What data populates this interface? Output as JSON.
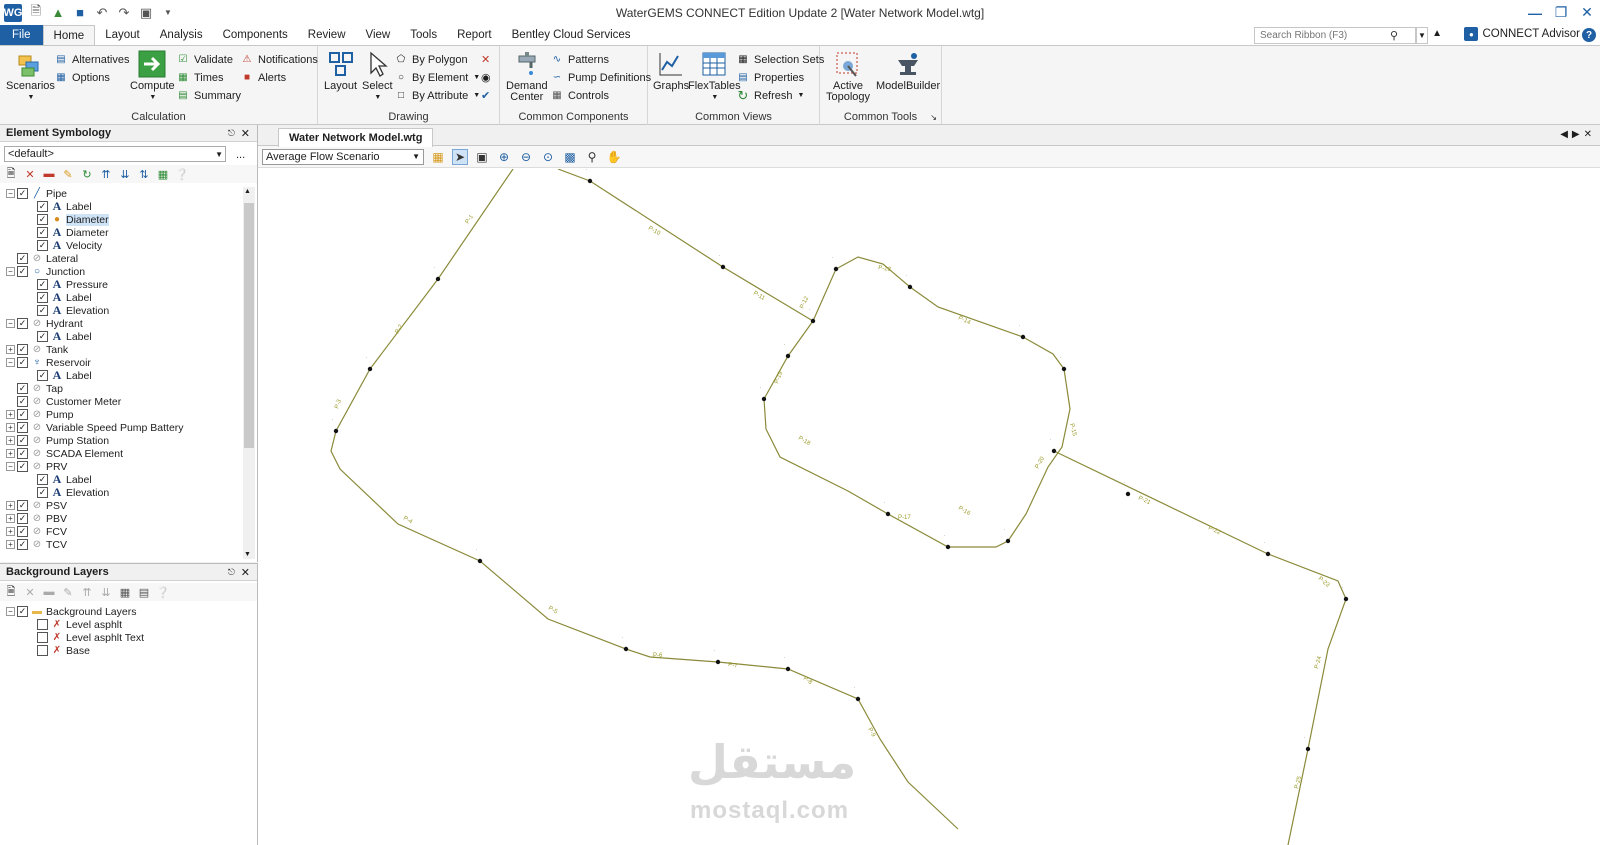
{
  "window": {
    "title": "WaterGEMS CONNECT Edition Update 2 [Water Network Model.wtg]",
    "logo": "WG",
    "controls": [
      "minimize-icon",
      "restore-icon",
      "close-icon"
    ]
  },
  "ribbon_tabs": [
    "File",
    "Home",
    "Layout",
    "Analysis",
    "Components",
    "Review",
    "View",
    "Tools",
    "Report",
    "Bentley Cloud Services"
  ],
  "active_tab": "Home",
  "search": {
    "placeholder": "Search Ribbon (F3)"
  },
  "connect_advisor": "CONNECT Advisor",
  "groups": {
    "calculation": {
      "label": "Calculation",
      "scenarios": "Scenarios",
      "alternatives": "Alternatives",
      "options": "Options",
      "compute": "Compute",
      "validate": "Validate",
      "times": "Times",
      "summary": "Summary",
      "notifications": "Notifications",
      "alerts": "Alerts"
    },
    "drawing": {
      "label": "Drawing",
      "layout": "Layout",
      "select": "Select",
      "by_polygon": "By Polygon",
      "by_element": "By Element",
      "by_attribute": "By Attribute"
    },
    "common_components": {
      "label": "Common Components",
      "demand_center_1": "Demand",
      "demand_center_2": "Center",
      "patterns": "Patterns",
      "pump_definitions": "Pump Definitions",
      "controls": "Controls"
    },
    "common_views": {
      "label": "Common Views",
      "graphs": "Graphs",
      "flextables": "FlexTables",
      "selection_sets": "Selection Sets",
      "properties": "Properties",
      "refresh": "Refresh"
    },
    "common_tools": {
      "label": "Common Tools",
      "active_topology_1": "Active",
      "active_topology_2": "Topology",
      "modelbuilder": "ModelBuilder"
    }
  },
  "symbology_panel": {
    "title": "Element Symbology",
    "selected": "<default>",
    "more": "...",
    "tree": [
      {
        "label": "Pipe",
        "level": 0,
        "exp": "minus",
        "icon": "pipe-icon",
        "checked": true
      },
      {
        "label": "Label",
        "level": 1,
        "icon": "A",
        "checked": true
      },
      {
        "label": "Diameter",
        "level": 1,
        "icon": "color-icon",
        "checked": true,
        "selected": true
      },
      {
        "label": "Diameter",
        "level": 1,
        "icon": "A",
        "checked": true
      },
      {
        "label": "Velocity",
        "level": 1,
        "icon": "A",
        "checked": true
      },
      {
        "label": "Lateral",
        "level": 0,
        "icon": "lateral-icon",
        "checked": true
      },
      {
        "label": "Junction",
        "level": 0,
        "exp": "minus",
        "icon": "junction-icon",
        "checked": true
      },
      {
        "label": "Pressure",
        "level": 1,
        "icon": "A",
        "checked": true
      },
      {
        "label": "Label",
        "level": 1,
        "icon": "A",
        "checked": true
      },
      {
        "label": "Elevation",
        "level": 1,
        "icon": "A",
        "checked": true
      },
      {
        "label": "Hydrant",
        "level": 0,
        "exp": "minus",
        "icon": "hydrant-icon",
        "checked": true
      },
      {
        "label": "Label",
        "level": 1,
        "icon": "A",
        "checked": true
      },
      {
        "label": "Tank",
        "level": 0,
        "exp": "plus",
        "icon": "tank-icon",
        "checked": true
      },
      {
        "label": "Reservoir",
        "level": 0,
        "exp": "minus",
        "icon": "reservoir-icon",
        "checked": true
      },
      {
        "label": "Label",
        "level": 1,
        "icon": "A",
        "checked": true
      },
      {
        "label": "Tap",
        "level": 0,
        "icon": "tap-icon",
        "checked": true
      },
      {
        "label": "Customer Meter",
        "level": 0,
        "icon": "meter-icon",
        "checked": true
      },
      {
        "label": "Pump",
        "level": 0,
        "exp": "plus",
        "icon": "pump-icon",
        "checked": true
      },
      {
        "label": "Variable Speed Pump Battery",
        "level": 0,
        "exp": "plus",
        "icon": "pump-icon",
        "checked": true
      },
      {
        "label": "Pump Station",
        "level": 0,
        "exp": "plus",
        "icon": "station-icon",
        "checked": true
      },
      {
        "label": "SCADA Element",
        "level": 0,
        "exp": "plus",
        "icon": "scada-icon",
        "checked": true
      },
      {
        "label": "PRV",
        "level": 0,
        "exp": "minus",
        "icon": "valve-icon",
        "checked": true
      },
      {
        "label": "Label",
        "level": 1,
        "icon": "A",
        "checked": true
      },
      {
        "label": "Elevation",
        "level": 1,
        "icon": "A",
        "checked": true
      },
      {
        "label": "PSV",
        "level": 0,
        "exp": "plus",
        "icon": "valve-icon",
        "checked": true
      },
      {
        "label": "PBV",
        "level": 0,
        "exp": "plus",
        "icon": "valve-icon",
        "checked": true
      },
      {
        "label": "FCV",
        "level": 0,
        "exp": "plus",
        "icon": "valve-icon",
        "checked": true
      },
      {
        "label": "TCV",
        "level": 0,
        "exp": "plus",
        "icon": "valve-icon",
        "checked": true
      }
    ]
  },
  "background_panel": {
    "title": "Background Layers",
    "tree": [
      {
        "label": "Background Layers",
        "level": 0,
        "exp": "minus",
        "icon": "folder-icon",
        "checked": true
      },
      {
        "label": "Level asphlt",
        "level": 1,
        "icon": "layer-icon",
        "checked": false
      },
      {
        "label": "Level asphlt Text",
        "level": 1,
        "icon": "layer-icon",
        "checked": false
      },
      {
        "label": "Base",
        "level": 1,
        "icon": "layer-icon",
        "checked": false
      }
    ]
  },
  "document": {
    "tab": "Water Network Model.wtg",
    "scenario": "Average Flow Scenario"
  },
  "watermark": {
    "arabic": "مستقل",
    "english": "mostaql.com"
  },
  "pipe_labels": [
    "P-1",
    "P-2",
    "P-3",
    "P-4",
    "P-5",
    "P-6",
    "P-7",
    "P-8",
    "P-9",
    "P-10",
    "P-11",
    "P-12",
    "P-13",
    "P-14",
    "P-15",
    "P-16",
    "P-17",
    "P-18",
    "P-19",
    "P-20",
    "P-21",
    "P-22",
    "P-23",
    "P-24",
    "P-25"
  ],
  "colors": {
    "accent": "#1f5fa3",
    "pipe": "#8a8a3a",
    "label": "#9a9a2a"
  }
}
